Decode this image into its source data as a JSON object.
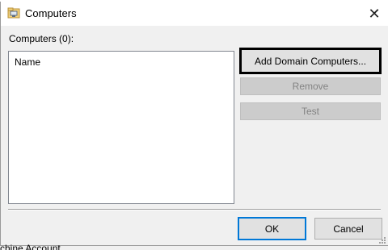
{
  "dialog": {
    "title": "Computers",
    "close_glyph": "✕"
  },
  "list": {
    "label": "Computers (0):",
    "column_header": "Name",
    "items": []
  },
  "buttons": {
    "add_domain_computers": "Add Domain Computers...",
    "remove": "Remove",
    "test": "Test",
    "ok": "OK",
    "cancel": "Cancel"
  },
  "background": {
    "partial_text": "chine Account"
  },
  "icons": {
    "title_icon": "computer-folder-icon",
    "close_icon": "close-icon",
    "resize_icon": "resize-grip-icon"
  },
  "colors": {
    "default_button_border": "#0078d7",
    "focus_border": "#000000",
    "disabled_text": "#838383"
  }
}
